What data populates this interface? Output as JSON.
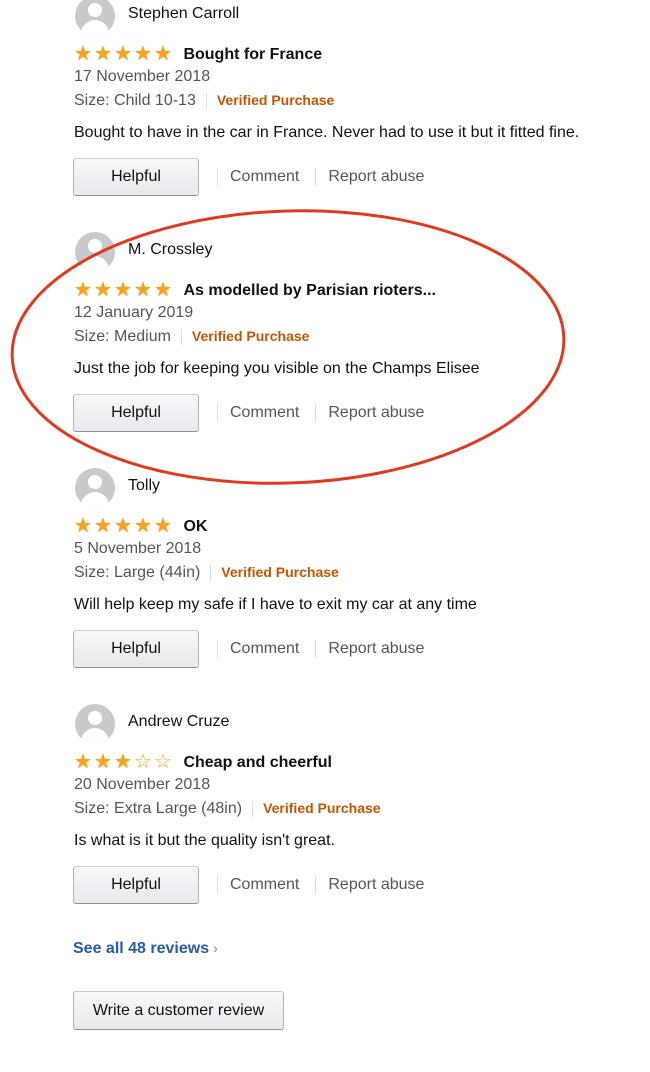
{
  "reviews": [
    {
      "author": "Stephen Carroll",
      "rating": 5,
      "stars_max": 5,
      "title": "Bought for France",
      "date": "17 November 2018",
      "size": "Size: Child 10-13",
      "verified": "Verified Purchase",
      "body": "Bought to have in the car in France. Never had to use it but it fitted fine.",
      "helpful_label": "Helpful",
      "comment_label": "Comment",
      "report_label": "Report abuse"
    },
    {
      "author": "M. Crossley",
      "rating": 5,
      "stars_max": 5,
      "title": "As modelled by Parisian rioters...",
      "date": "12 January 2019",
      "size": "Size: Medium",
      "verified": "Verified Purchase",
      "body": "Just the job for keeping you visible on the Champs Elisee",
      "helpful_label": "Helpful",
      "comment_label": "Comment",
      "report_label": "Report abuse"
    },
    {
      "author": "Tolly",
      "rating": 5,
      "stars_max": 5,
      "title": "OK",
      "date": "5 November 2018",
      "size": "Size: Large (44in)",
      "verified": "Verified Purchase",
      "body": "Will help keep my safe if I have to exit my car at any time",
      "helpful_label": "Helpful",
      "comment_label": "Comment",
      "report_label": "Report abuse"
    },
    {
      "author": "Andrew Cruze",
      "rating": 3,
      "stars_max": 5,
      "title": "Cheap and cheerful",
      "date": "20 November 2018",
      "size": "Size: Extra Large (48in)",
      "verified": "Verified Purchase",
      "body": "Is what is it but the quality isn't great.",
      "helpful_label": "Helpful",
      "comment_label": "Comment",
      "report_label": "Report abuse"
    }
  ],
  "see_all": {
    "label": "See all 48 reviews",
    "chevron": "›"
  },
  "write_review": {
    "label": "Write a customer review"
  },
  "annotation": {
    "shape": "ellipse",
    "color": "#e03a1e",
    "highlights_review_index": 1
  },
  "colors": {
    "star": "#f6a41d",
    "verified": "#c45500",
    "link": "#2a59a8"
  },
  "icons": {
    "avatar": "user-avatar-icon",
    "star_filled": "star-filled-icon",
    "star_empty": "star-empty-icon"
  }
}
